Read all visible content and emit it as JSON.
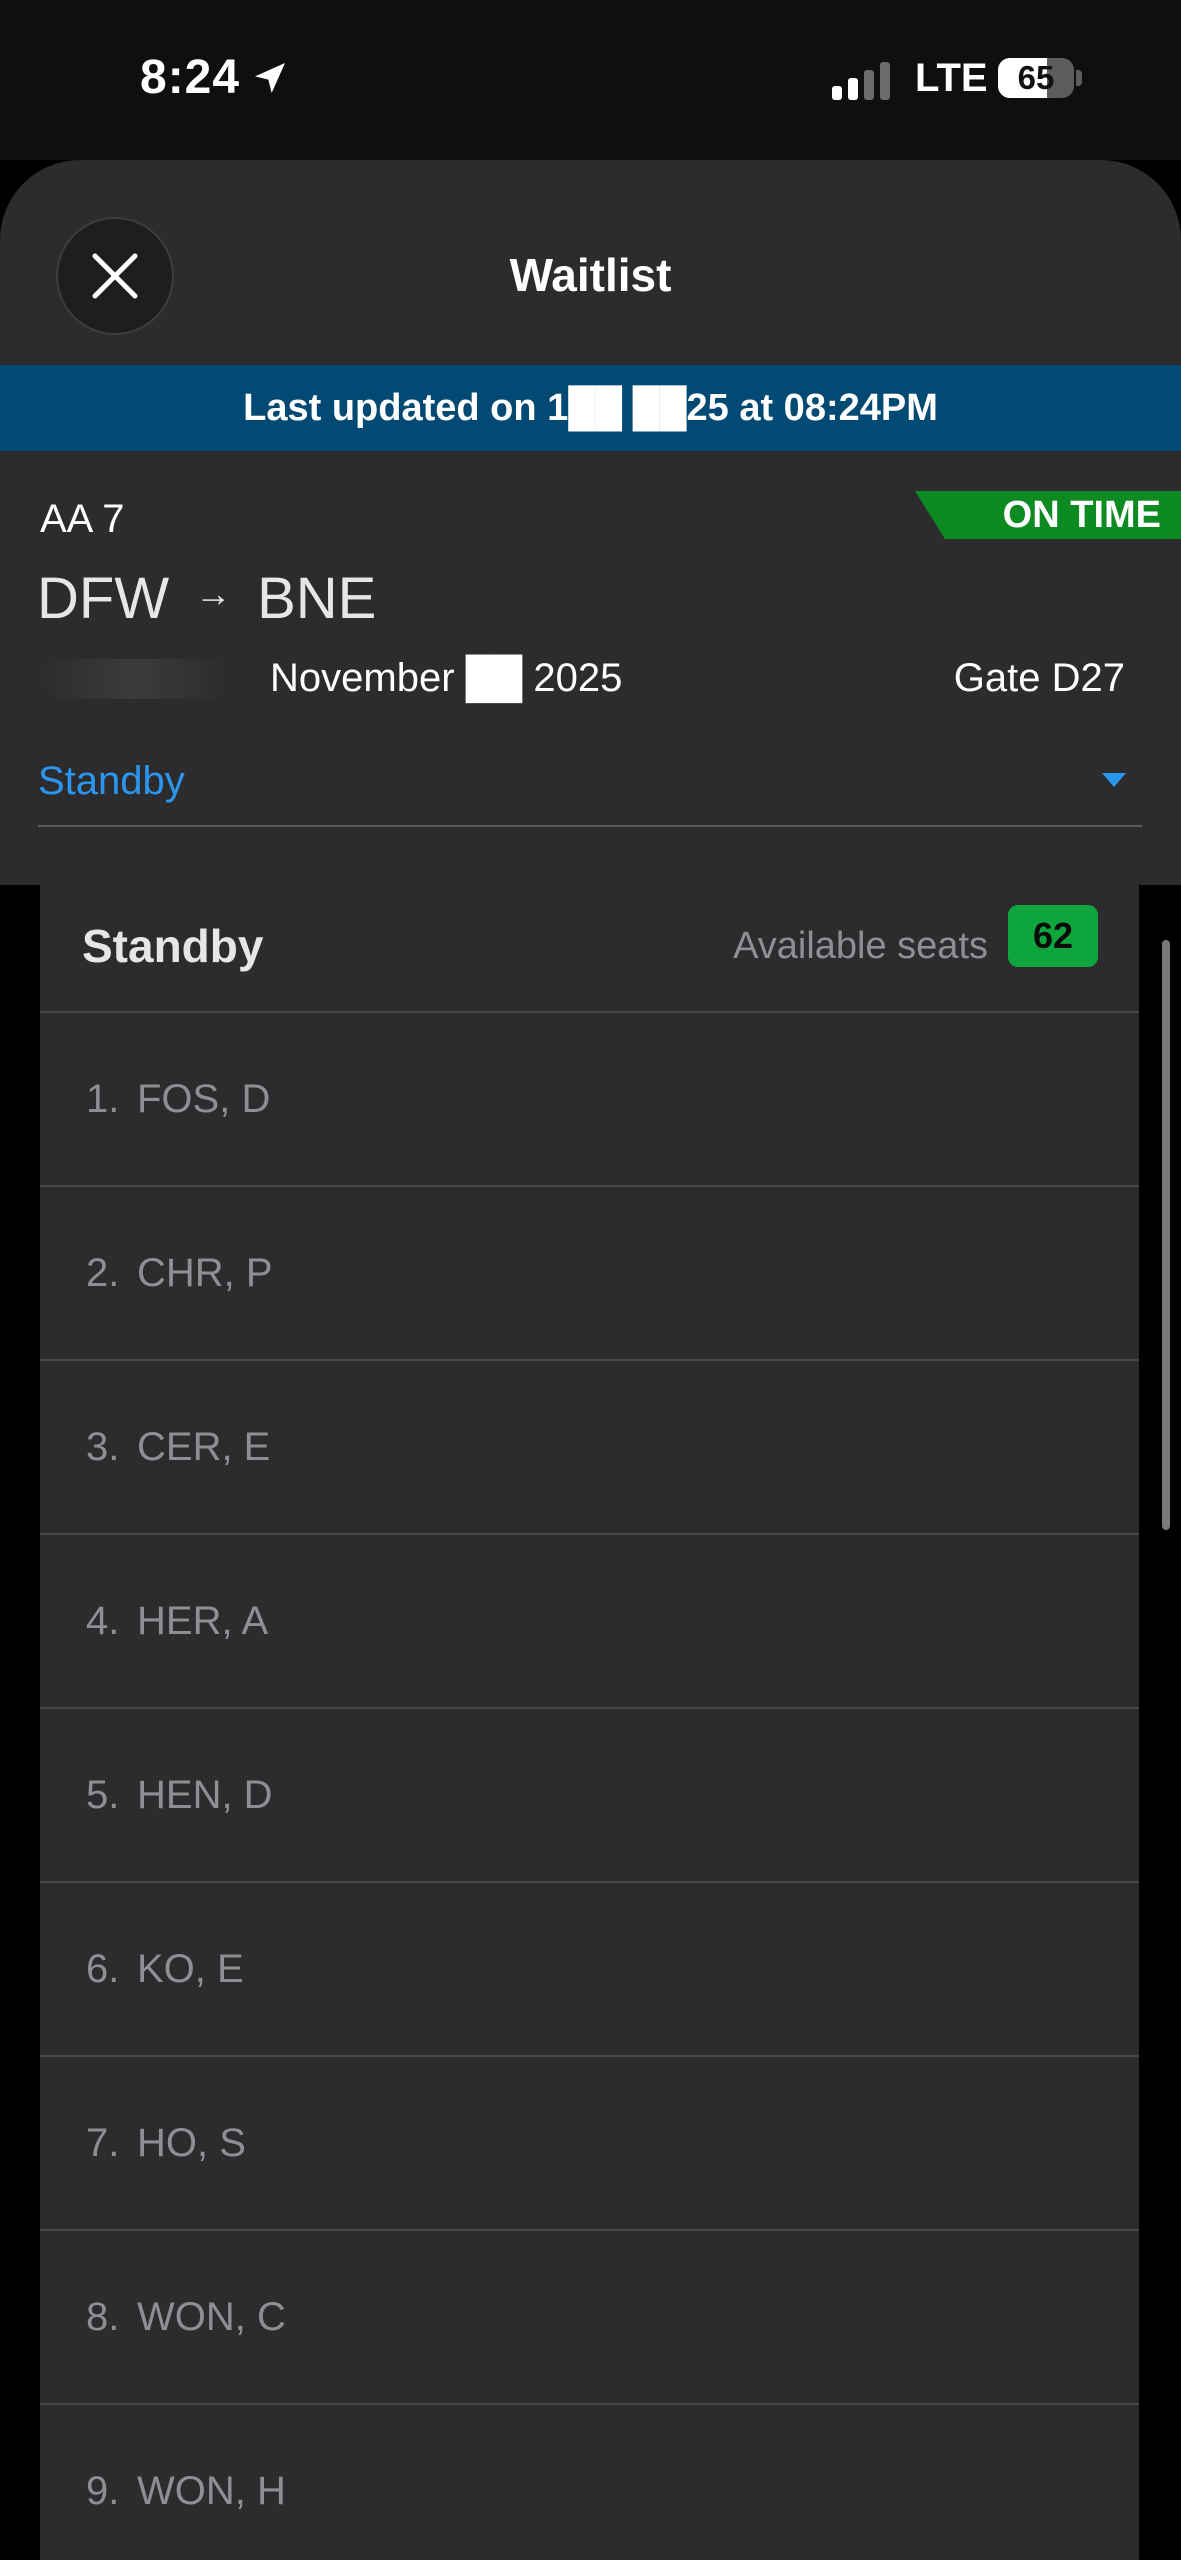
{
  "status_bar": {
    "time": "8:24",
    "network": "LTE",
    "battery": "65",
    "battery_level": 65
  },
  "sheet": {
    "title": "Waitlist",
    "last_updated": "Last updated on 1██ ██25 at 08:24PM"
  },
  "flight": {
    "number": "AA 7",
    "status": "ON TIME",
    "status_color": "#0d8a22",
    "origin": "DFW",
    "destination": "BNE",
    "date": "November ██ 2025",
    "gate": "Gate D27",
    "list_selector": "Standby"
  },
  "standby": {
    "title": "Standby",
    "available_seats_label": "Available seats",
    "available_seats": "62",
    "entries": [
      {
        "index": "1.",
        "name": "FOS, D"
      },
      {
        "index": "2.",
        "name": "CHR, P"
      },
      {
        "index": "3.",
        "name": "CER, E"
      },
      {
        "index": "4.",
        "name": "HER, A"
      },
      {
        "index": "5.",
        "name": "HEN, D"
      },
      {
        "index": "6.",
        "name": "KO, E"
      },
      {
        "index": "7.",
        "name": "HO, S"
      },
      {
        "index": "8.",
        "name": "WON, C"
      },
      {
        "index": "9.",
        "name": "WON, H"
      }
    ]
  },
  "colors": {
    "accent": "#2b96f0",
    "banner": "#024a73",
    "seats_badge": "#0fa53d"
  },
  "icons": [
    "location-arrow-icon",
    "close-icon",
    "arrow-right-icon",
    "chevron-down-icon"
  ]
}
